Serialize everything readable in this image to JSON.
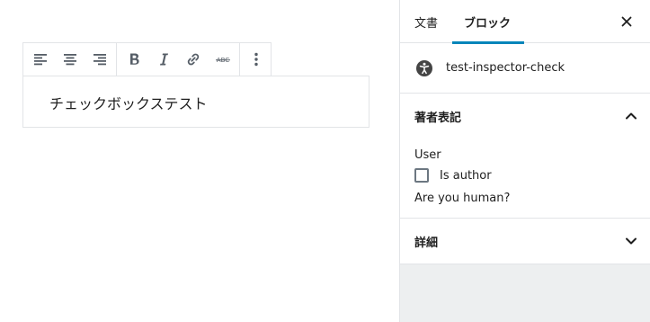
{
  "toolbar": {
    "alignment": [
      {
        "name": "align-left-icon"
      },
      {
        "name": "align-center-icon"
      },
      {
        "name": "align-right-icon"
      }
    ],
    "format": [
      {
        "name": "bold-icon"
      },
      {
        "name": "italic-icon"
      },
      {
        "name": "link-icon"
      },
      {
        "name": "strikethrough-icon",
        "glyph": "ABC"
      }
    ],
    "more": {
      "name": "more-options-icon"
    }
  },
  "block": {
    "content": "チェックボックステスト"
  },
  "sidebar": {
    "tabs": [
      {
        "label": "文書"
      },
      {
        "label": "ブロック"
      }
    ],
    "active_tab": "ブロック",
    "accent": "#0085ba",
    "block_card": {
      "icon": "accessibility-icon",
      "title": "test-inspector-check"
    },
    "panels": [
      {
        "title": "著者表記",
        "open": true,
        "user_label": "User",
        "checkbox_label": "Is author",
        "checked": false,
        "help": "Are you human?"
      },
      {
        "title": "詳細",
        "open": false
      }
    ]
  }
}
